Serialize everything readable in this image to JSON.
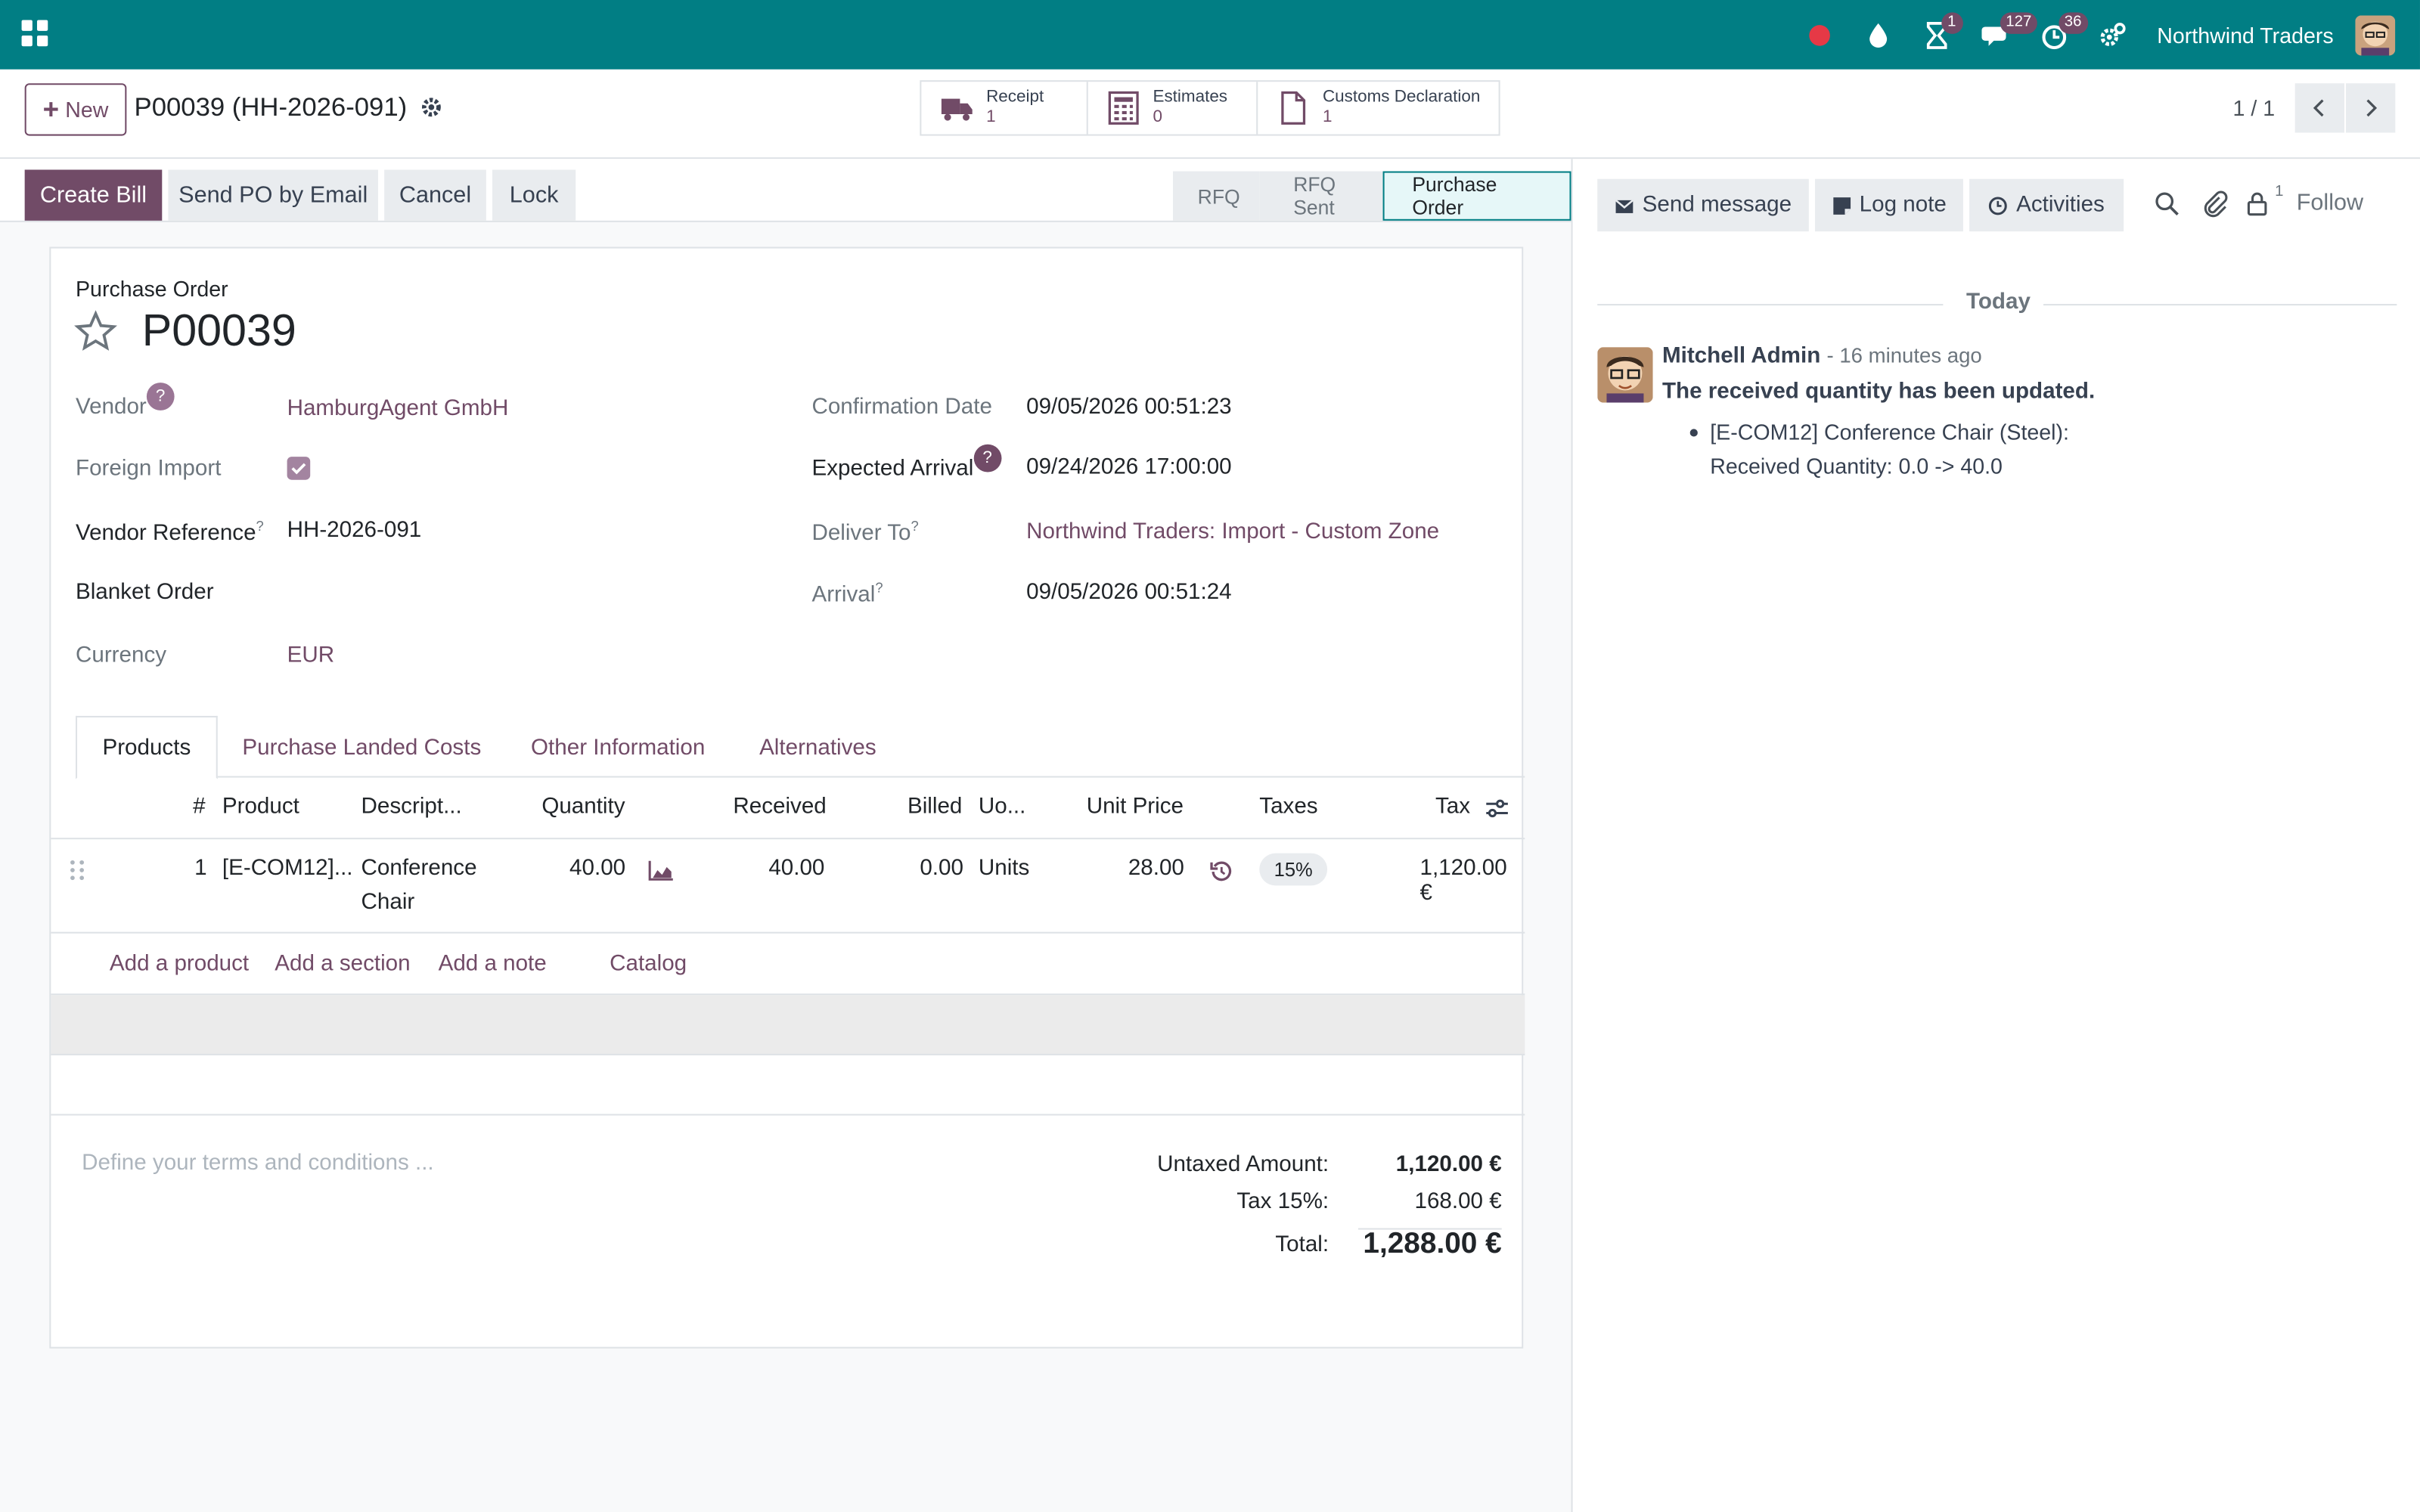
{
  "navbar": {
    "company": "Northwind Traders",
    "badges": {
      "activities": "1",
      "messages": "127",
      "timer": "36"
    }
  },
  "control_panel": {
    "new_label": "New",
    "record_title": "P00039 (HH-2026-091)",
    "smart_buttons": [
      {
        "title": "Receipt",
        "value": "1"
      },
      {
        "title": "Estimates",
        "value": "0"
      },
      {
        "title": "Customs Declaration",
        "value": "1"
      }
    ],
    "pager": "1 / 1"
  },
  "statusbar": {
    "buttons": [
      "Create Bill",
      "Send PO by Email",
      "Cancel",
      "Lock"
    ],
    "stages": [
      "RFQ",
      "RFQ Sent",
      "Purchase Order"
    ]
  },
  "form": {
    "type_label": "Purchase Order",
    "name": "P00039",
    "left_fields": {
      "vendor_label": "Vendor",
      "vendor_value": "HamburgAgent GmbH",
      "foreign_label": "Foreign Import",
      "vref_label": "Vendor Reference",
      "vref_value": "HH-2026-091",
      "blanket_label": "Blanket Order",
      "currency_label": "Currency",
      "currency_value": "EUR"
    },
    "right_fields": {
      "confirm_label": "Confirmation Date",
      "confirm_value": "09/05/2026 00:51:23",
      "expected_label": "Expected Arrival",
      "expected_value": "09/24/2026 17:00:00",
      "deliver_label": "Deliver To",
      "deliver_value": "Northwind Traders: Import - Custom Zone",
      "arrival_label": "Arrival",
      "arrival_value": "09/05/2026 00:51:24"
    },
    "help_mark": "?",
    "tabs": [
      "Products",
      "Purchase Landed Costs",
      "Other Information",
      "Alternatives"
    ]
  },
  "table": {
    "headers": [
      "#",
      "Product",
      "Descript...",
      "Quantity",
      "Received",
      "Billed",
      "Uo...",
      "Unit Price",
      "Taxes",
      "Tax"
    ],
    "row": {
      "num": "1",
      "product": "[E-COM12]...",
      "desc1": "Conference",
      "desc2": "Chair",
      "qty": "40.00",
      "received": "40.00",
      "billed": "0.00",
      "uom": "Units",
      "price": "28.00",
      "taxes": "15%",
      "tax": "1,120.00 €"
    },
    "add_links": [
      "Add a product",
      "Add a section",
      "Add a note",
      "Catalog"
    ],
    "terms_placeholder": "Define your terms and conditions ..."
  },
  "totals": {
    "untaxed_label": "Untaxed Amount:",
    "untaxed_value": "1,120.00 €",
    "tax_label": "Tax 15%:",
    "tax_value": "168.00 €",
    "total_label": "Total:",
    "total_value": "1,288.00 €"
  },
  "chatter": {
    "send_message": "Send message",
    "log_note": "Log note",
    "activities": "Activities",
    "followers_count": "1",
    "follow": "Follow",
    "today": "Today",
    "message": {
      "author": "Mitchell Admin",
      "time": "- 16 minutes ago",
      "body": "The received quantity has been updated.",
      "item_line1": "[E-COM12] Conference Chair (Steel):",
      "item_line2": "Received Quantity: 0.0 -> 40.0"
    }
  }
}
